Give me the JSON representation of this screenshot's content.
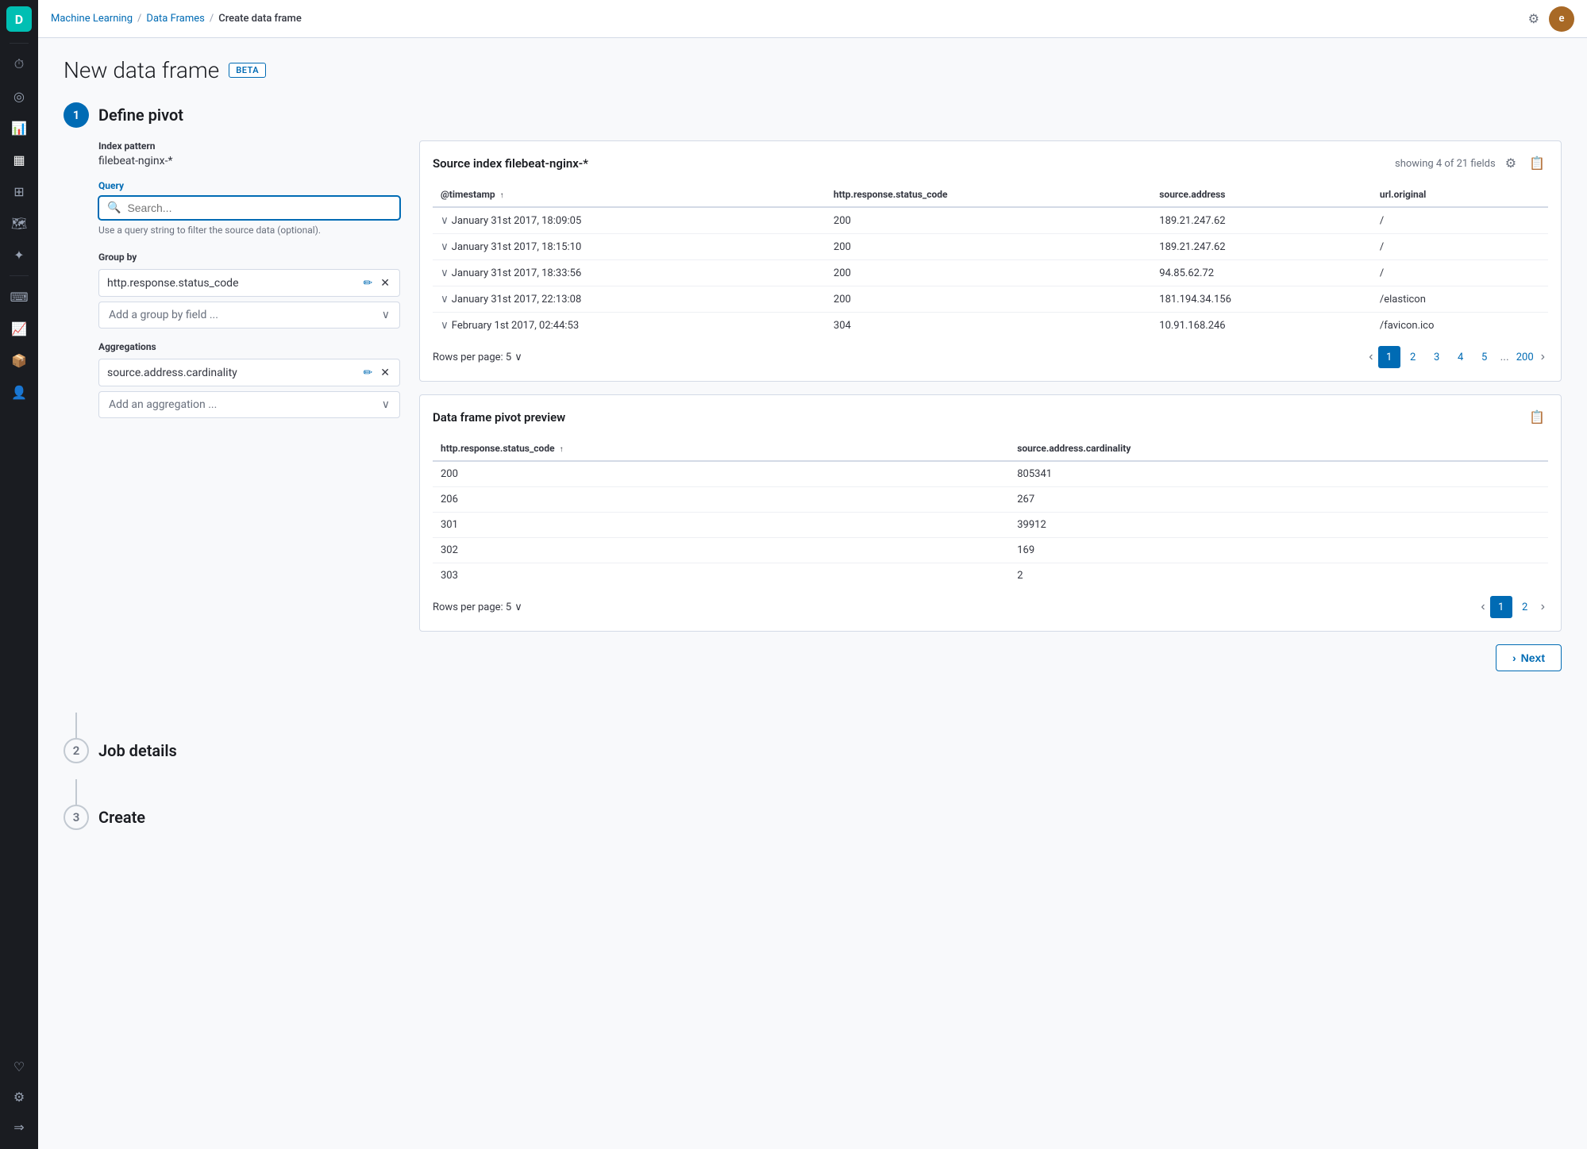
{
  "app": {
    "logo_letter": "D",
    "breadcrumb": {
      "items": [
        "Machine Learning",
        "Data Frames",
        "Create data frame"
      ]
    },
    "user_initial": "e"
  },
  "nav": {
    "icons": [
      "⏱",
      "◎",
      "▦",
      "⊞",
      "☰",
      "⚙",
      "↔",
      "♡",
      "⚙"
    ]
  },
  "page": {
    "title": "New data frame",
    "beta_badge": "BETA"
  },
  "step1": {
    "number": "1",
    "title": "Define pivot",
    "index_pattern_label": "Index pattern",
    "index_pattern_value": "filebeat-nginx-*",
    "query_label": "Query",
    "search_placeholder": "Search...",
    "search_hint": "Use a query string to filter the source data (optional).",
    "group_by_label": "Group by",
    "group_by_field": "http.response.status_code",
    "add_group_placeholder": "Add a group by field ...",
    "aggregations_label": "Aggregations",
    "aggregation_field": "source.address.cardinality",
    "add_aggregation_placeholder": "Add an aggregation ..."
  },
  "source_table": {
    "title": "Source index filebeat-nginx-*",
    "meta": "showing 4 of 21 fields",
    "columns": [
      "@timestamp",
      "http.response.status_code",
      "source.address",
      "url.original"
    ],
    "rows": [
      {
        "expand": true,
        "timestamp": "January 31st 2017, 18:09:05",
        "status_code": "200",
        "address": "189.21.247.62",
        "url": "/"
      },
      {
        "expand": true,
        "timestamp": "January 31st 2017, 18:15:10",
        "status_code": "200",
        "address": "189.21.247.62",
        "url": "/"
      },
      {
        "expand": true,
        "timestamp": "January 31st 2017, 18:33:56",
        "status_code": "200",
        "address": "94.85.62.72",
        "url": "/"
      },
      {
        "expand": true,
        "timestamp": "January 31st 2017, 22:13:08",
        "status_code": "200",
        "address": "181.194.34.156",
        "url": "/elasticon"
      },
      {
        "expand": true,
        "timestamp": "February 1st 2017, 02:44:53",
        "status_code": "304",
        "address": "10.91.168.246",
        "url": "/favicon.ico"
      }
    ],
    "pagination": {
      "rows_per_page": "Rows per page: 5",
      "pages": [
        "1",
        "2",
        "3",
        "4",
        "5"
      ],
      "ellipsis": "...",
      "last_page": "200",
      "active_page": "1"
    }
  },
  "pivot_preview": {
    "title": "Data frame pivot preview",
    "columns": [
      "http.response.status_code",
      "source.address.cardinality"
    ],
    "rows": [
      {
        "status_code": "200",
        "cardinality": "805341"
      },
      {
        "status_code": "206",
        "cardinality": "267"
      },
      {
        "status_code": "301",
        "cardinality": "39912"
      },
      {
        "status_code": "302",
        "cardinality": "169"
      },
      {
        "status_code": "303",
        "cardinality": "2"
      }
    ],
    "pagination": {
      "rows_per_page": "Rows per page: 5",
      "pages": [
        "1",
        "2"
      ],
      "active_page": "1"
    }
  },
  "next_button": {
    "label": "Next"
  },
  "step2": {
    "number": "2",
    "title": "Job details"
  },
  "step3": {
    "number": "3",
    "title": "Create"
  }
}
